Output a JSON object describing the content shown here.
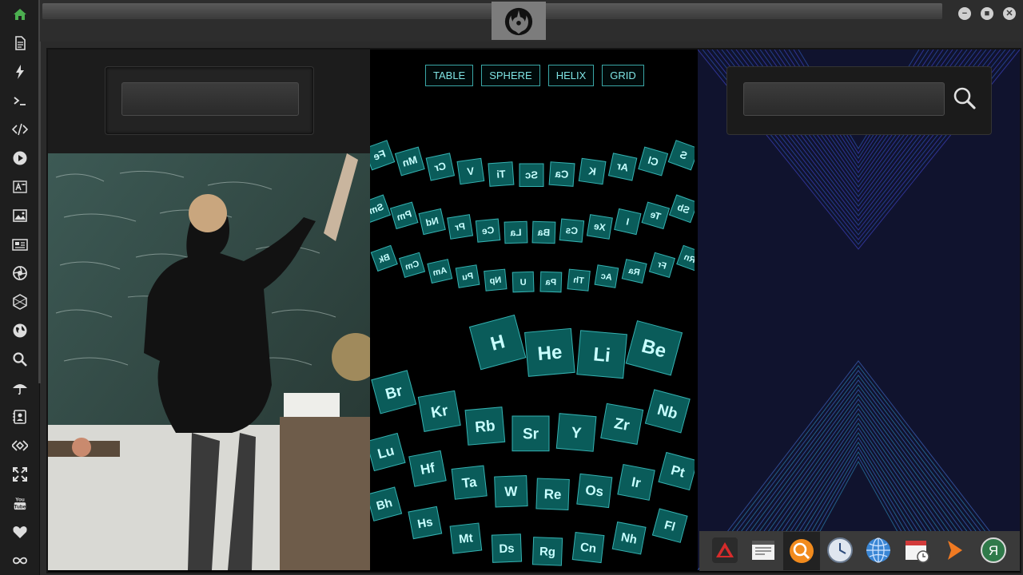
{
  "sidebar": {
    "items": [
      {
        "icon": "home-icon",
        "color": "#4caf50"
      },
      {
        "icon": "document-icon"
      },
      {
        "icon": "lightning-icon"
      },
      {
        "icon": "terminal-icon"
      },
      {
        "icon": "code-icon"
      },
      {
        "icon": "play-icon"
      },
      {
        "icon": "translate-icon"
      },
      {
        "icon": "image-icon"
      },
      {
        "icon": "news-icon"
      },
      {
        "icon": "aperture-icon"
      },
      {
        "icon": "hexagon-icon"
      },
      {
        "icon": "globe-icon"
      },
      {
        "icon": "search-icon"
      },
      {
        "icon": "umbrella-icon"
      },
      {
        "icon": "contact-card-icon"
      },
      {
        "icon": "diamond-code-icon"
      },
      {
        "icon": "expand-icon"
      },
      {
        "icon": "youtube-icon",
        "label": "You Tube"
      },
      {
        "icon": "heart-icon"
      },
      {
        "icon": "infinity-icon"
      }
    ]
  },
  "window": {
    "controls": [
      "minimize",
      "maximize",
      "close"
    ],
    "emblem": "rebel-alliance-icon"
  },
  "left_panel": {
    "search": {
      "value": "",
      "placeholder": ""
    }
  },
  "mid_panel": {
    "tabs": [
      "TABLE",
      "SPHERE",
      "HELIX",
      "GRID"
    ],
    "elements_ring1": [
      "Fe",
      "Mn",
      "Cr",
      "V",
      "Ti",
      "Sc",
      "Ca",
      "K",
      "Ar",
      "Cl",
      "S"
    ],
    "elements_ring2": [
      "Sm",
      "Pm",
      "Nd",
      "Pr",
      "Ce",
      "La",
      "Ba",
      "Cs",
      "Xe",
      "I",
      "Te",
      "Sb"
    ],
    "elements_ring3": [
      "Bk",
      "Cm",
      "Am",
      "Pu",
      "Np",
      "U",
      "Pa",
      "Th",
      "Ac",
      "Ra",
      "Fr",
      "Rn"
    ],
    "elements_ring4": [
      "H",
      "He",
      "Li",
      "Be"
    ],
    "elements_ring5": [
      "Br",
      "Kr",
      "Rb",
      "Sr",
      "Y",
      "Zr",
      "Nb"
    ],
    "elements_ring6": [
      "Lu",
      "Hf",
      "Ta",
      "W",
      "Re",
      "Os",
      "Ir",
      "Pt"
    ],
    "elements_ring7": [
      "Bh",
      "Hs",
      "Mt",
      "Ds",
      "Rg",
      "Cn",
      "Nh",
      "Fl"
    ],
    "accent_color": "#3fd0d0"
  },
  "right_panel": {
    "search": {
      "value": "",
      "placeholder": ""
    },
    "search_icon": "magnifier-icon"
  },
  "dock": {
    "items": [
      {
        "icon": "red-triangle-app-icon"
      },
      {
        "icon": "newspaper-app-icon"
      },
      {
        "icon": "search-app-icon",
        "active": true
      },
      {
        "icon": "clock-app-icon"
      },
      {
        "icon": "globe-app-icon"
      },
      {
        "icon": "calendar-app-icon"
      },
      {
        "icon": "orange-arrow-app-icon"
      },
      {
        "icon": "yandex-app-icon",
        "label": "Я"
      }
    ]
  }
}
